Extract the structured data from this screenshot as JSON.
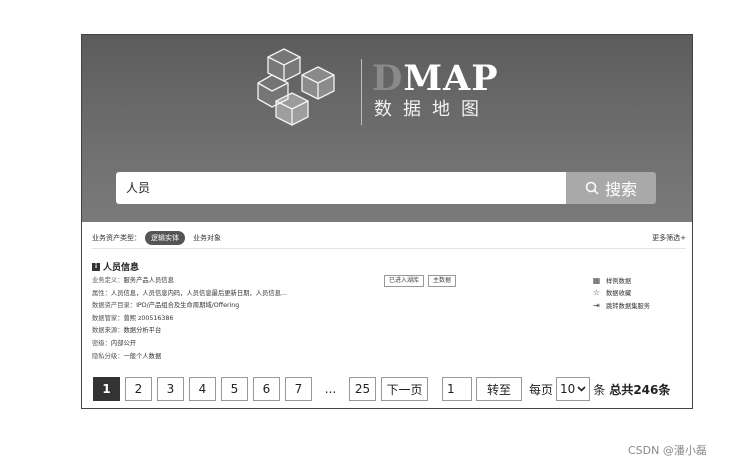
{
  "hero": {
    "brand": "MAP",
    "brand_ghost": "D",
    "brand_sub": "数据地图"
  },
  "search": {
    "value": "人员",
    "button_label": "搜索",
    "icon": "search-icon"
  },
  "filter": {
    "label": "业务资产类型：",
    "active_chip": "逻辑实体",
    "chip": "业务对象",
    "more": "更多筛选+"
  },
  "result": {
    "title": "人员信息",
    "title_icon": "info",
    "fields": [
      {
        "k": "业务定义：",
        "v": "服务产品人员信息"
      },
      {
        "k": "属性：",
        "v": "人员信息，人员信息内码，人员信息最后更新日期，人员信息..."
      },
      {
        "k": "数据资产目录：",
        "v": "IPD/产品组合及生命周期域/Offering"
      },
      {
        "k": "数据管家：",
        "v": "曾熙 z00516386"
      },
      {
        "k": "数据来源：",
        "v": "数据分析平台"
      },
      {
        "k": "密级：",
        "v": "内部公开"
      },
      {
        "k": "隐私分级：",
        "v": "一般个人数据"
      }
    ],
    "tags": [
      "已进入湖库",
      "主数据"
    ],
    "actions": [
      {
        "icon": "table-icon",
        "label": "样例数据"
      },
      {
        "icon": "star-icon",
        "label": "数据收藏"
      },
      {
        "icon": "export-icon",
        "label": "跳转数据集服务"
      }
    ]
  },
  "pagination": {
    "pages": [
      "1",
      "2",
      "3",
      "4",
      "5",
      "6",
      "7"
    ],
    "active": "1",
    "ellipsis": "...",
    "last": "25",
    "next": "下一页",
    "jump_value": "1",
    "jump_btn": "转至",
    "per_page_label": "每页",
    "per_page_value": "10",
    "per_page_unit": "条",
    "total": "总共246条"
  },
  "watermark": "CSDN @潘小磊",
  "colors": {
    "hero_bg": "#6a6a6a",
    "search_btn": "#a9a9a9",
    "active": "#333333"
  }
}
